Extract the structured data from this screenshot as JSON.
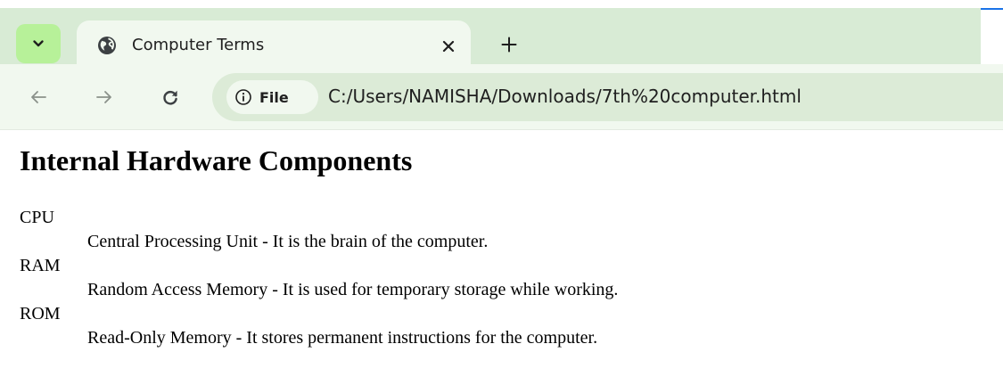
{
  "browser": {
    "tab": {
      "title": "Computer Terms",
      "favicon": "globe-icon"
    },
    "toolbar": {
      "site_info_label": "File",
      "url": "C:/Users/NAMISHA/Downloads/7th%20computer.html"
    },
    "icons": {
      "tab_list": "chevron-down-icon",
      "close": "close-icon",
      "new_tab": "plus-icon",
      "back": "arrow-left-icon",
      "forward": "arrow-right-icon",
      "reload": "reload-icon",
      "site_info": "info-icon"
    },
    "colors": {
      "frame": "#d8ebd5",
      "toolbar": "#f1f8ef",
      "omnibox": "#dcebd7",
      "tab_list_button": "#b7f199",
      "accent": "#1a73e8"
    }
  },
  "page": {
    "heading": "Internal Hardware Components",
    "terms": [
      {
        "term": "CPU",
        "definition": "Central Processing Unit - It is the brain of the computer."
      },
      {
        "term": "RAM",
        "definition": "Random Access Memory - It is used for temporary storage while working."
      },
      {
        "term": "ROM",
        "definition": "Read-Only Memory - It stores permanent instructions for the computer."
      }
    ]
  }
}
